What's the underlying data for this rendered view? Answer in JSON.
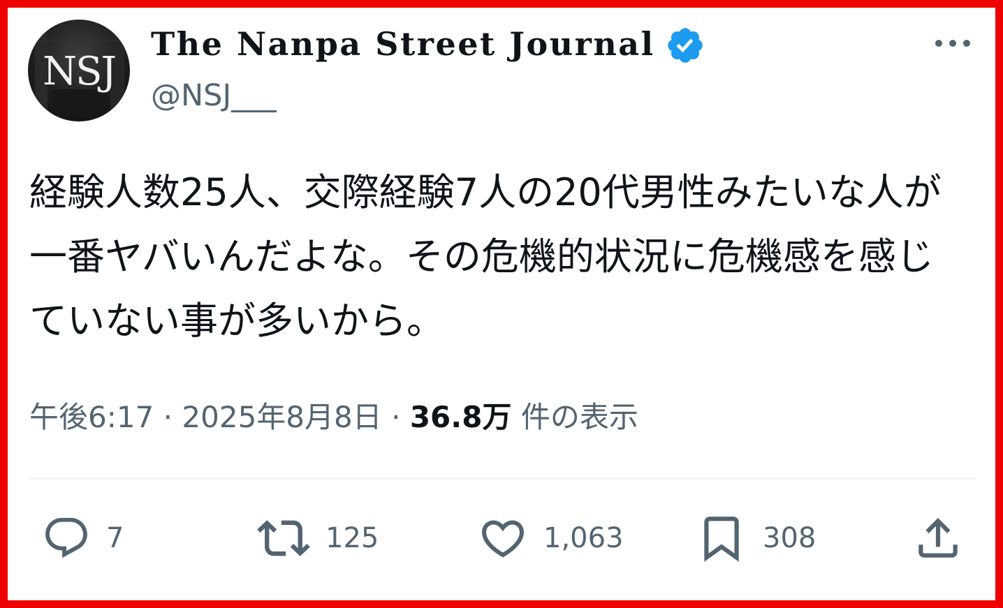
{
  "tweet": {
    "author": {
      "display_name": "The Nanpa Street Journal",
      "handle": "@NSJ___",
      "avatar_text": "NSJ",
      "verified": true,
      "verified_color": "#1d9bf0"
    },
    "text": "経験人数25人、交際経験7人の20代男性みたいな人が一番ヤバいんだよな。その危機的状況に危機感を感じていない事が多いから。",
    "time": "午後6:17",
    "date": "2025年8月8日",
    "separator": "·",
    "views_count": "36.8万",
    "views_label": "件の表示",
    "more_icon": "more-horizontal-icon"
  },
  "actions": {
    "reply": {
      "icon": "reply-icon",
      "count": "7"
    },
    "retweet": {
      "icon": "retweet-icon",
      "count": "125"
    },
    "like": {
      "icon": "heart-icon",
      "count": "1,063"
    },
    "bookmark": {
      "icon": "bookmark-icon",
      "count": "308"
    },
    "share": {
      "icon": "share-icon"
    }
  },
  "colors": {
    "frame_border": "#ee0000",
    "primary_text": "#0f1419",
    "secondary_text": "#536471",
    "divider": "#eff3f4"
  }
}
